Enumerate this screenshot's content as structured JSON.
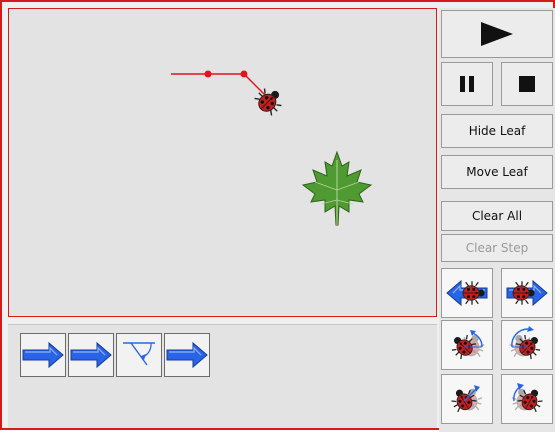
{
  "controls": {
    "play_icon": "play-icon",
    "pause_icon": "pause-icon",
    "stop_icon": "stop-icon",
    "hide_leaf_label": "Hide Leaf",
    "move_leaf_label": "Move Leaf",
    "clear_all_label": "Clear All",
    "clear_step_label": "Clear Step"
  },
  "program": {
    "commands": [
      "forward-arrow-icon",
      "forward-arrow-icon",
      "turn-angle-icon",
      "forward-arrow-icon"
    ]
  },
  "palette": {
    "icons": [
      "back-ladybug-icon",
      "forward-ladybug-icon",
      "turn-left-ladybug-icon",
      "turn-right-ladybug-icon",
      "small-turn-left-ladybug-icon",
      "small-turn-right-ladybug-icon"
    ]
  },
  "scene": {
    "ladybug_icon": "ladybug-icon",
    "leaf_icon": "maple-leaf-icon"
  },
  "colors": {
    "frame_border": "#d21b1b",
    "path_line": "#e0161b",
    "arrow_blue": "#2a64e6",
    "leaf_green": "#4f9a31"
  }
}
